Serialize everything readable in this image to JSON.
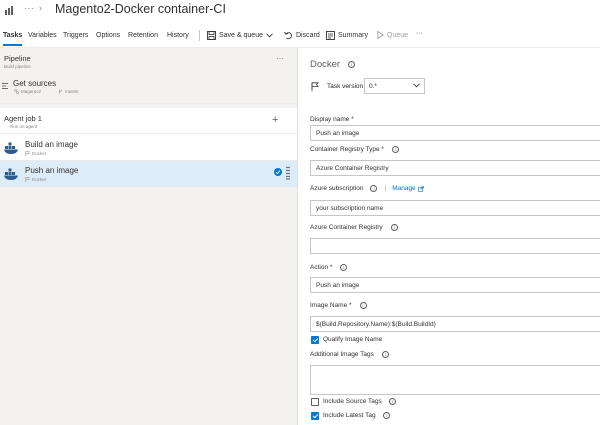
{
  "title_bar": {
    "breadcrumb_more": "···",
    "breadcrumb_separator": "›",
    "pipeline_name": "Magento2-Docker container-CI"
  },
  "tabs": [
    {
      "label": "Tasks",
      "active": true
    },
    {
      "label": "Variables",
      "active": false
    },
    {
      "label": "Triggers",
      "active": false
    },
    {
      "label": "Options",
      "active": false
    },
    {
      "label": "Retention",
      "active": false
    },
    {
      "label": "History",
      "active": false
    }
  ],
  "toolbar": {
    "save_queue": "Save & queue",
    "discard": "Discard",
    "summary": "Summary",
    "queue": "Queue",
    "more": "···"
  },
  "pipeline_section": {
    "title": "Pipeline",
    "subtitle": "Build pipeline",
    "more": "···"
  },
  "get_sources": {
    "title": "Get sources",
    "repo": "Magento2",
    "branch": "master"
  },
  "agent_job": {
    "title": "Agent job 1",
    "subtitle": "Run on agent",
    "add": "+"
  },
  "tasks": [
    {
      "title": "Build an image",
      "subtitle": "Docker",
      "selected": false
    },
    {
      "title": "Push an image",
      "subtitle": "Docker",
      "selected": true
    }
  ],
  "details": {
    "task_name": "Docker",
    "task_version_label": "Task version",
    "task_version_value": "0.*",
    "display_name_label": "Display name *",
    "display_name_value": "Push an image",
    "registry_type_label": "Container Registry Type *",
    "registry_type_value": "Azure Container Registry",
    "azure_subscription_label": "Azure subscription",
    "manage_label": "Manage",
    "manage_separator": "|",
    "azure_subscription_value": "your subscription name",
    "acr_label": "Azure Container Registry",
    "acr_value": "",
    "action_label": "Action *",
    "action_value": "Push an image",
    "image_name_label": "Image Name *",
    "image_name_value": "$(Build.Repository.Name):$(Build.BuildId)",
    "qualify_image_name_label": "Qualify Image Name",
    "qualify_image_name_checked": true,
    "additional_tags_label": "Additional Image Tags",
    "additional_tags_value": "",
    "include_source_tags_label": "Include Source Tags",
    "include_source_tags_checked": false,
    "include_latest_tag_label": "Include Latest Tag",
    "include_latest_tag_checked": true
  },
  "colors": {
    "accent": "#0078d4",
    "selected_row": "#deecf9",
    "panel_bg": "#f3f2f1"
  }
}
